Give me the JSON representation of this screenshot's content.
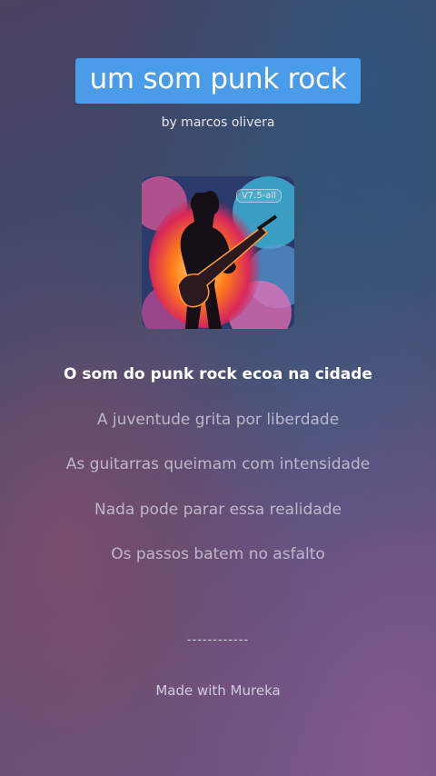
{
  "song": {
    "title": "um som punk rock",
    "author": "by marcos olivera",
    "cover_badge": "V7.5-all"
  },
  "lyrics": [
    "O som do punk rock ecoa na cidade",
    "A juventude grita por liberdade",
    "As guitarras queimam com intensidade",
    "Nada pode parar essa realidade",
    "Os passos batem no asfalto"
  ],
  "footer": {
    "divider": "------------",
    "made_with": "Made with Mureka"
  },
  "colors": {
    "title_bg": "#4a9be8",
    "active_lyric": "#ffffff"
  }
}
